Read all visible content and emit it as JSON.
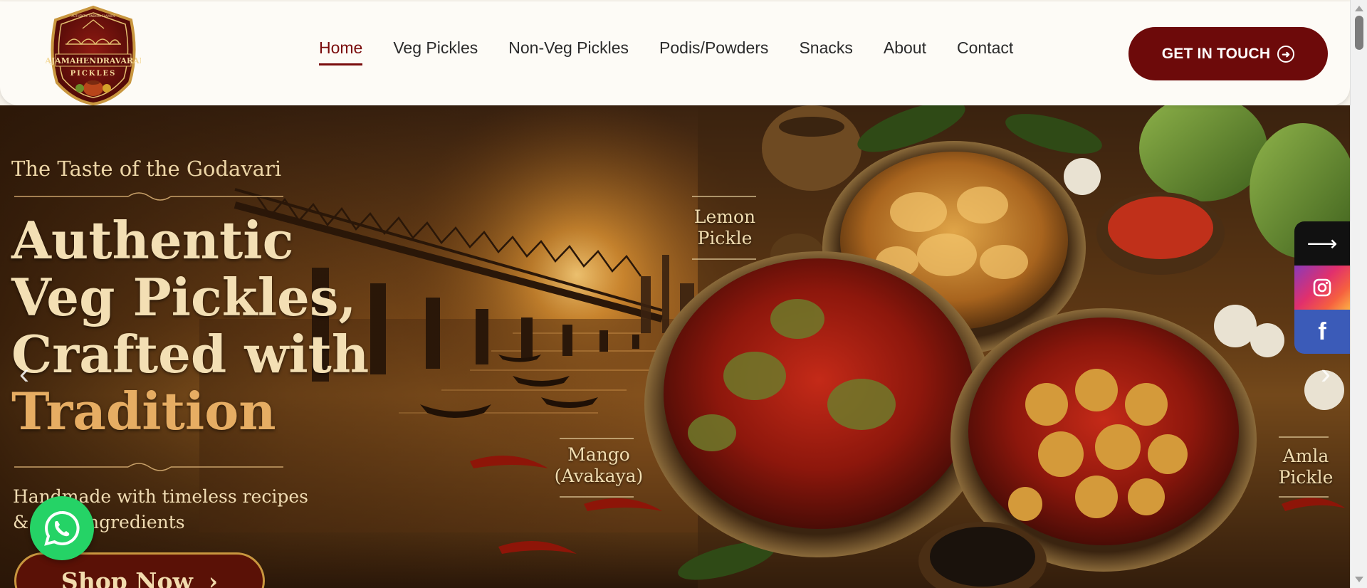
{
  "brand": {
    "logo_name": "RAJAMAHENDRAVARAM",
    "logo_sub": "PICKLES",
    "logo_tagline": "AUTHENTIC ANDHRA FLAVORS"
  },
  "nav": {
    "items": [
      {
        "label": "Home",
        "active": true
      },
      {
        "label": "Veg Pickles",
        "active": false
      },
      {
        "label": "Non-Veg Pickles",
        "active": false
      },
      {
        "label": "Podis/Powders",
        "active": false
      },
      {
        "label": "Snacks",
        "active": false
      },
      {
        "label": "About",
        "active": false
      },
      {
        "label": "Contact",
        "active": false
      }
    ],
    "cta_label": "GET IN TOUCH"
  },
  "hero": {
    "eyebrow": "The Taste of the Godavari",
    "headline_line1": "Authentic",
    "headline_line2": "Veg Pickles,",
    "headline_line3": "Crafted with",
    "headline_line4": "Tradition",
    "subtext_line1": "Handmade with timeless recipes",
    "subtext_line2": "& pure ingredients",
    "shop_button": "Shop Now",
    "labels": {
      "lemon_line1": "Lemon",
      "lemon_line2": "Pickle",
      "mango_line1": "Mango",
      "mango_line2": "(Avakaya)",
      "amla_line1": "Amla",
      "amla_line2": "Pickle"
    }
  },
  "social": {
    "toggle_icon": "arrow-right-icon",
    "instagram_icon": "instagram-icon",
    "facebook_icon": "facebook-icon"
  },
  "colors": {
    "brand": "#6d0a0a",
    "header_bg": "#fdfbf6",
    "whatsapp": "#25d366",
    "facebook": "#3b5bb8"
  }
}
